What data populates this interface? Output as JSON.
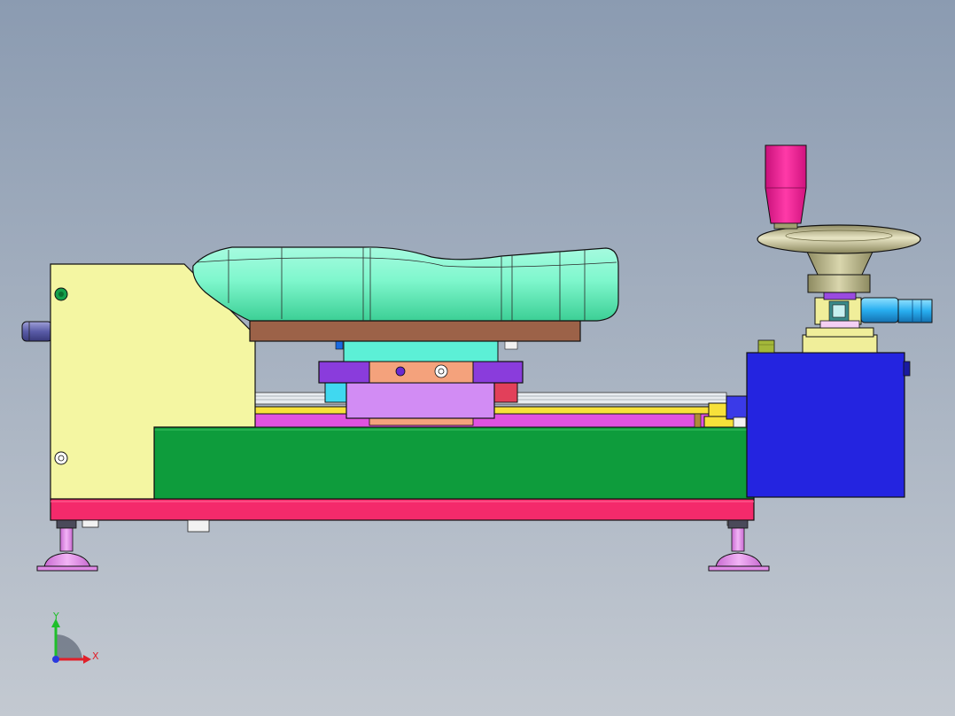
{
  "viewport": {
    "background_top": "#8b9bb1",
    "background_bottom": "#c3c9d1"
  },
  "triad": {
    "x_label": "X",
    "y_label": "Y",
    "x_color": "#e0202a",
    "y_color": "#1fbf2a",
    "z_color": "#2a3adf"
  },
  "colors": {
    "base_plate": "#f42a6b",
    "green_block": "#0e9c3c",
    "side_plate": "#f4f6a2",
    "blue_block": "#2424e0",
    "seat_cushion": "#6ff3c0",
    "seat_plate": "#9c6248",
    "handwheel": "#cbc79a",
    "handle": "#ff1f96",
    "rail_yellow": "#f7e13a",
    "violet": "#8a3cdc",
    "lilac": "#d28cf4",
    "salmon": "#f4a27c",
    "cyan_block": "#5cf0d6",
    "magenta_bar": "#e052e0",
    "levelling_foot": "#e48cec"
  }
}
